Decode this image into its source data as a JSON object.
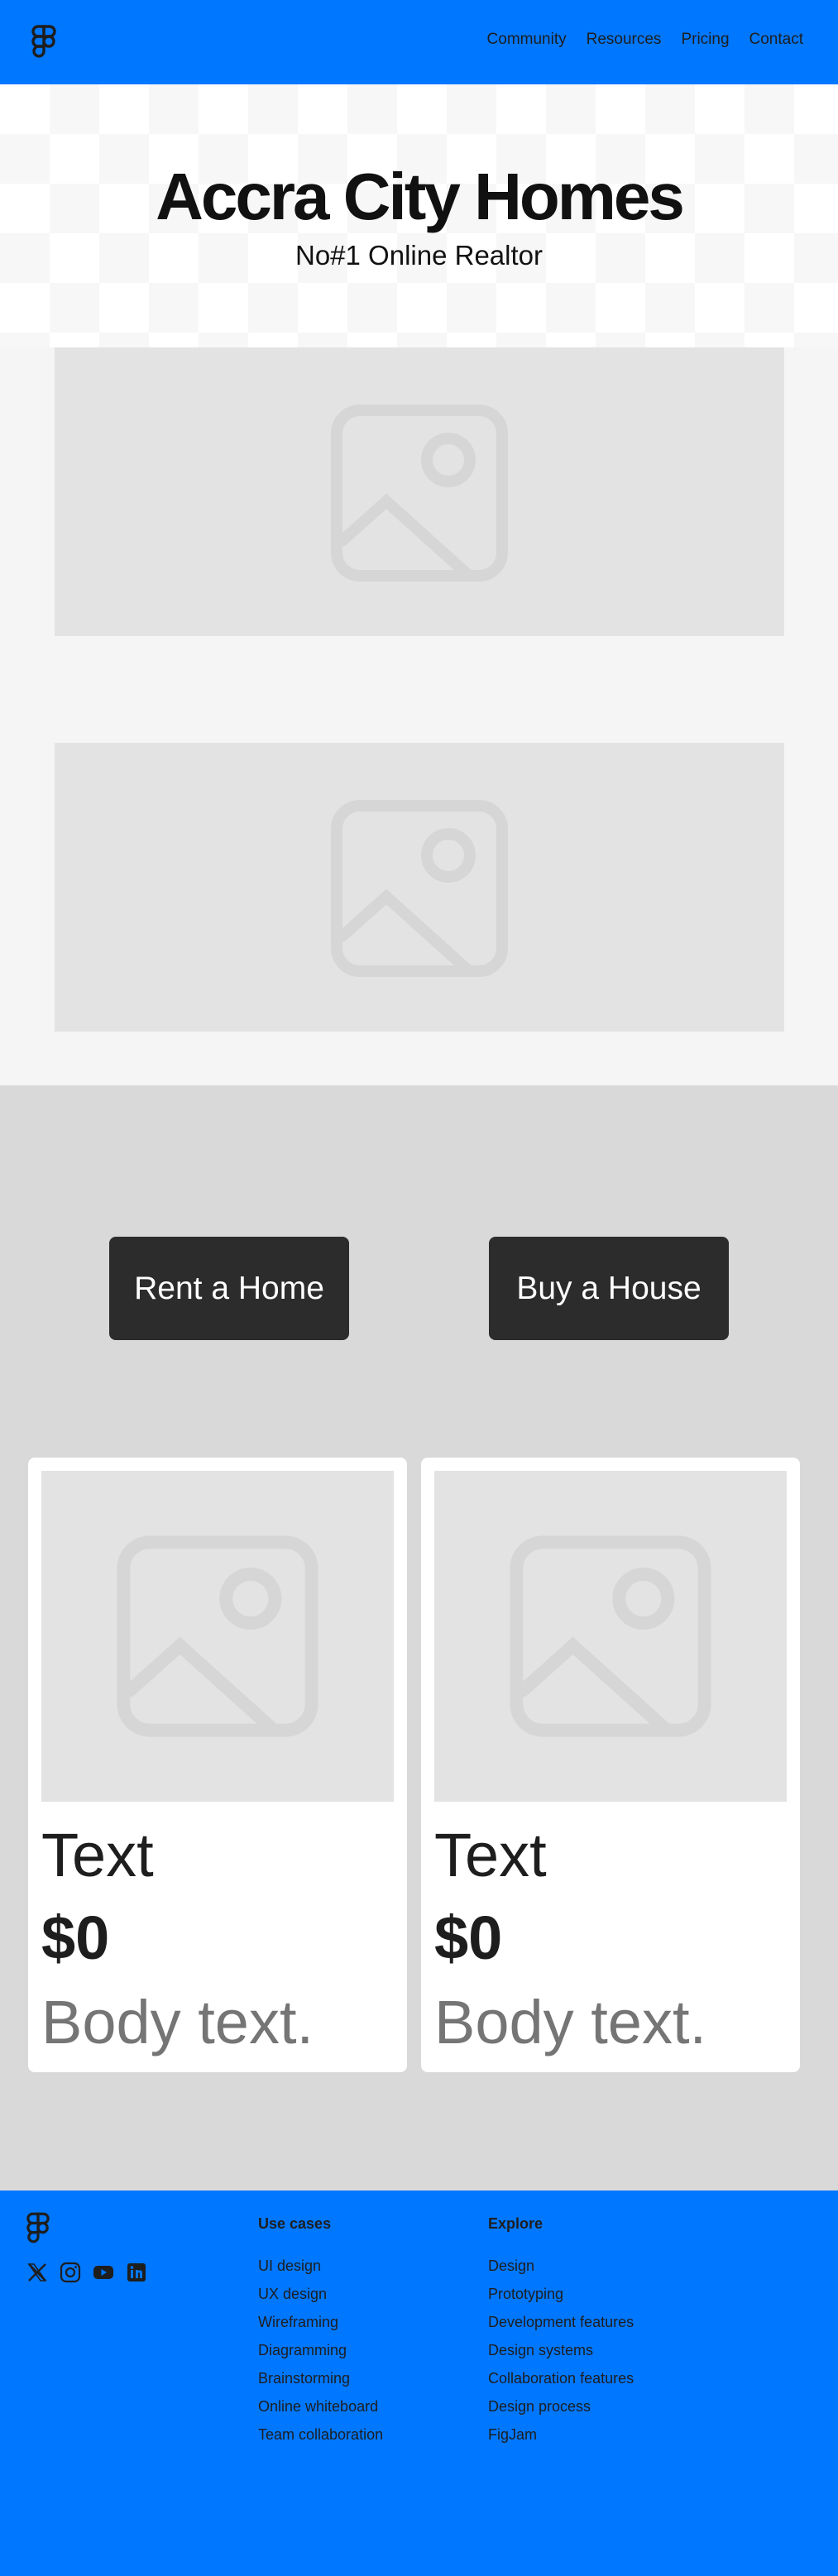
{
  "header": {
    "logo_icon": "figma-logo-icon",
    "nav": [
      "Community",
      "Resources",
      "Pricing",
      "Contact"
    ]
  },
  "hero": {
    "title": "Accra City Homes",
    "subtitle": "No#1 Online Realtor"
  },
  "gallery": {
    "images": [
      "image-placeholder-icon",
      "image-placeholder-icon"
    ]
  },
  "actions": {
    "rent_label": "Rent a Home",
    "buy_label": "Buy a House"
  },
  "cards": [
    {
      "title": "Text",
      "price": "$0",
      "body": "Body text.",
      "image": "image-placeholder-icon"
    },
    {
      "title": "Text",
      "price": "$0",
      "body": "Body text.",
      "image": "image-placeholder-icon"
    }
  ],
  "footer": {
    "logo_icon": "figma-logo-icon",
    "socials": [
      "x-icon",
      "instagram-icon",
      "youtube-icon",
      "linkedin-icon"
    ],
    "columns": [
      {
        "title": "Use cases",
        "items": [
          "UI design",
          "UX design",
          "Wireframing",
          "Diagramming",
          "Brainstorming",
          "Online whiteboard",
          "Team collaboration"
        ]
      },
      {
        "title": "Explore",
        "items": [
          "Design",
          "Prototyping",
          "Development features",
          "Design systems",
          "Collaboration features",
          "Design process",
          "FigJam"
        ]
      }
    ]
  },
  "colors": {
    "brand_blue": "#0077ff",
    "button_dark": "#2c2c2c",
    "placeholder_gray": "#e3e3e3",
    "section_gray": "#d9d9d9"
  }
}
